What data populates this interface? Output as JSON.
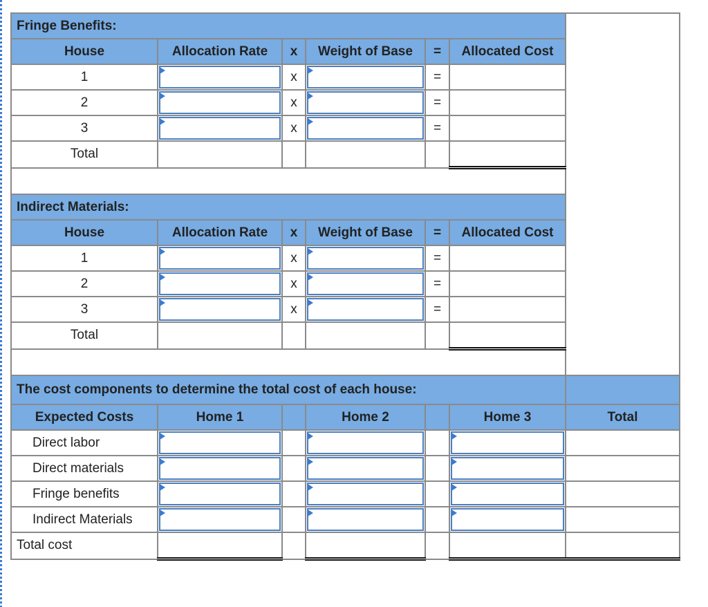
{
  "fringe": {
    "title": "Fringe Benefits:",
    "headers": {
      "house": "House",
      "rate": "Allocation Rate",
      "times": "x",
      "weight": "Weight of Base",
      "equals": "=",
      "cost": "Allocated Cost"
    },
    "rows": [
      {
        "house": "1",
        "times": "x",
        "equals": "=",
        "rate": "",
        "weight": ""
      },
      {
        "house": "2",
        "times": "x",
        "equals": "=",
        "rate": "",
        "weight": ""
      },
      {
        "house": "3",
        "times": "x",
        "equals": "=",
        "rate": "",
        "weight": ""
      }
    ],
    "total_label": "Total"
  },
  "indirect": {
    "title": "Indirect Materials:",
    "headers": {
      "house": "House",
      "rate": "Allocation Rate",
      "times": "x",
      "weight": "Weight of Base",
      "equals": "=",
      "cost": "Allocated Cost"
    },
    "rows": [
      {
        "house": "1",
        "times": "x",
        "equals": "=",
        "rate": "",
        "weight": ""
      },
      {
        "house": "2",
        "times": "x",
        "equals": "=",
        "rate": "",
        "weight": ""
      },
      {
        "house": "3",
        "times": "x",
        "equals": "=",
        "rate": "",
        "weight": ""
      }
    ],
    "total_label": "Total"
  },
  "components": {
    "title": "The cost components to determine the total cost of each house:",
    "headers": {
      "expected": "Expected Costs",
      "home1": "Home 1",
      "home2": "Home 2",
      "home3": "Home 3",
      "total": "Total"
    },
    "rows": [
      {
        "label": "Direct labor",
        "home1": "",
        "home2": "",
        "home3": ""
      },
      {
        "label": "Direct materials",
        "home1": "",
        "home2": "",
        "home3": ""
      },
      {
        "label": "Fringe benefits",
        "home1": "",
        "home2": "",
        "home3": ""
      },
      {
        "label": "Indirect Materials",
        "home1": "",
        "home2": "",
        "home3": ""
      }
    ],
    "total_label": "Total cost"
  },
  "colors": {
    "header_blue": "#78ace3",
    "input_border": "#4a7fc1",
    "grid": "#8a8a8a"
  }
}
